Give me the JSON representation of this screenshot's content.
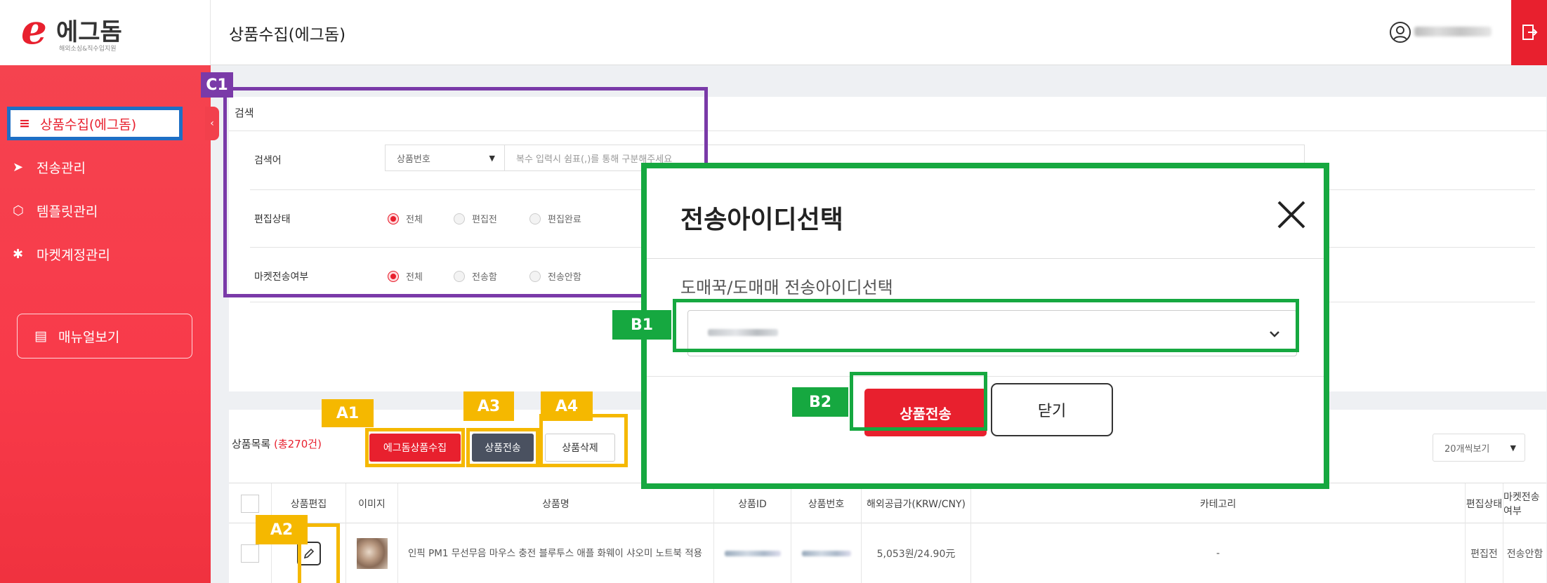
{
  "logo": {
    "text": "에그돔",
    "subtext": "해외소싱&직수입지원"
  },
  "header": {
    "page_title": "상품수집(에그돔)"
  },
  "sidebar": {
    "items": [
      {
        "label": "상품수집(에그돔)",
        "icon": "list-icon",
        "active": true
      },
      {
        "label": "전송관리",
        "icon": "arrow-right-icon"
      },
      {
        "label": "템플릿관리",
        "icon": "box-icon"
      },
      {
        "label": "마켓계정관리",
        "icon": "gear-icon"
      }
    ],
    "manual_label": "매뉴얼보기"
  },
  "search": {
    "title": "검색",
    "keyword_label": "검색어",
    "keyword_type": "상품번호",
    "keyword_placeholder": "복수 입력시 쉼표(,)를 통해 구분해주세요",
    "edit_status_label": "편집상태",
    "edit_status_options": [
      "전체",
      "편집전",
      "편집완료"
    ],
    "market_status_label": "마켓전송여부",
    "market_status_options": [
      "전체",
      "전송함",
      "전송안함"
    ]
  },
  "product_list": {
    "title": "상품목록",
    "count": "(총270건)",
    "collect_button": "에그돔상품수집",
    "send_button": "상품전송",
    "delete_button": "상품삭제",
    "page_size": "20개씩보기",
    "columns": [
      "상품편집",
      "이미지",
      "상품명",
      "상품ID",
      "상품번호",
      "해외공급가(KRW/CNY)",
      "카테고리",
      "편집상태",
      "마켓전송여부"
    ],
    "rows": [
      {
        "name": "인픽 PM1 무선무음 마우스 충전 블루투스 애플 화웨이 샤오미 노트북 적용",
        "price": "5,053원/24.90元",
        "category": "-",
        "edit_status": "편집전",
        "market_status": "전송안함"
      }
    ]
  },
  "modal": {
    "title": "전송아이디선택",
    "field_label": "도매꾹/도매매 전송아이디선택",
    "submit_label": "상품전송",
    "close_label": "닫기"
  },
  "annotations": {
    "A1": "A1",
    "A2": "A2",
    "A3": "A3",
    "A4": "A4",
    "B1": "B1",
    "B2": "B2",
    "C1": "C1"
  },
  "colors": {
    "brand_red": "#e8202e",
    "annotation_yellow": "#f5b800",
    "annotation_green": "#16a840",
    "annotation_purple": "#7a3aa8",
    "annotation_blue": "#1e6fc5"
  }
}
